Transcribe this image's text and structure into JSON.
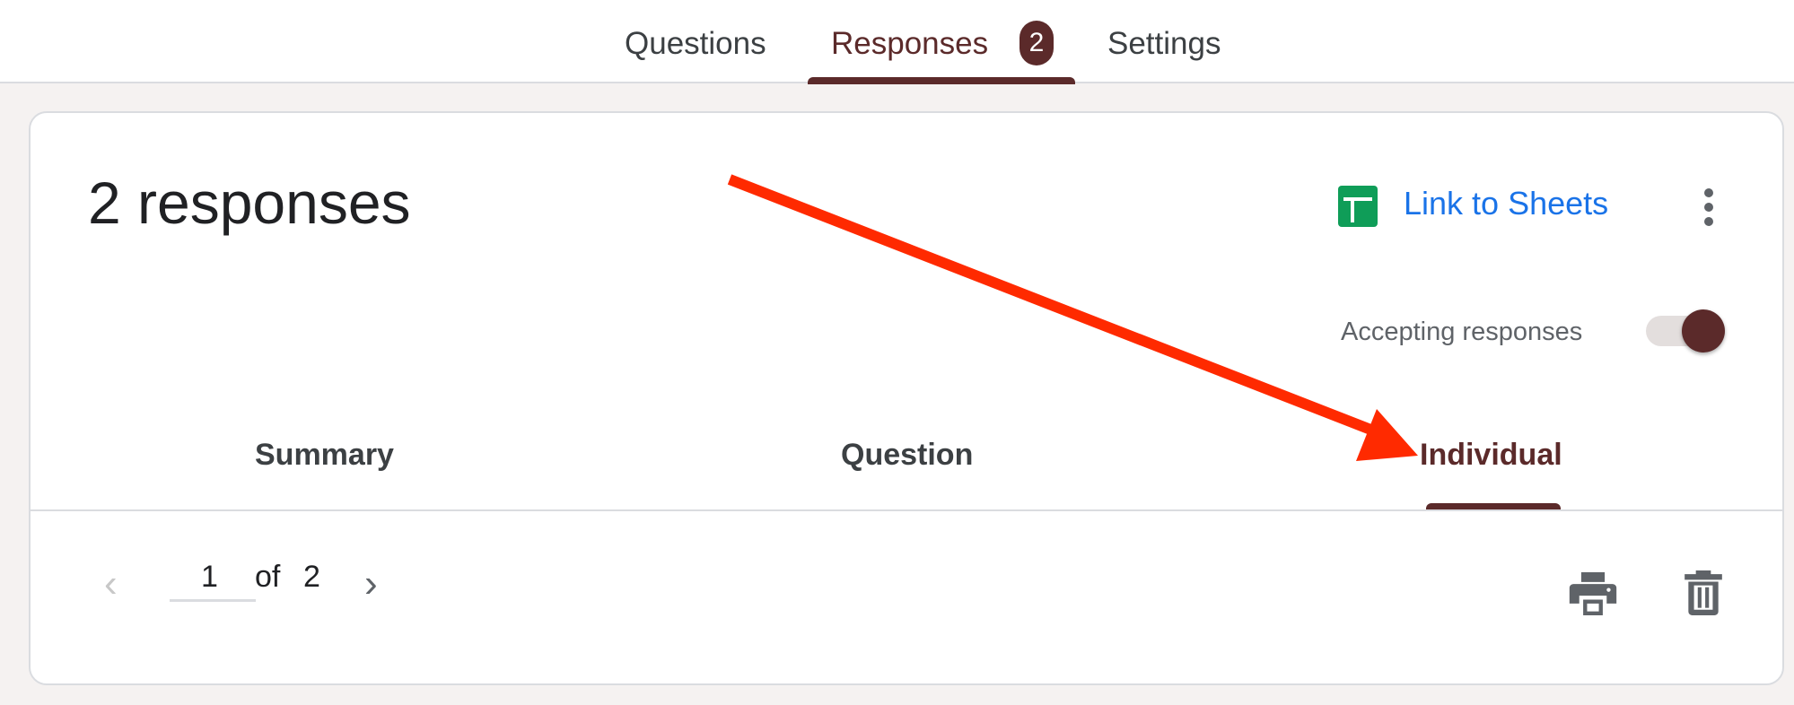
{
  "top_tabs": [
    {
      "label": "Questions"
    },
    {
      "label": "Responses",
      "badge": "2"
    },
    {
      "label": "Settings"
    }
  ],
  "card": {
    "title": "2 responses",
    "link_sheets": "Link to Sheets",
    "accepting_label": "Accepting responses",
    "accepting": true,
    "sub_tabs": [
      {
        "label": "Summary"
      },
      {
        "label": "Question"
      },
      {
        "label": "Individual"
      }
    ],
    "pager": {
      "current": "1",
      "of": "of",
      "total": "2",
      "prev": "‹",
      "next": "›"
    }
  },
  "colors": {
    "accent": "#5b2a2a",
    "link": "#1a73e8",
    "arrow": "#ff2a00",
    "sheets": "#0f9d58"
  }
}
